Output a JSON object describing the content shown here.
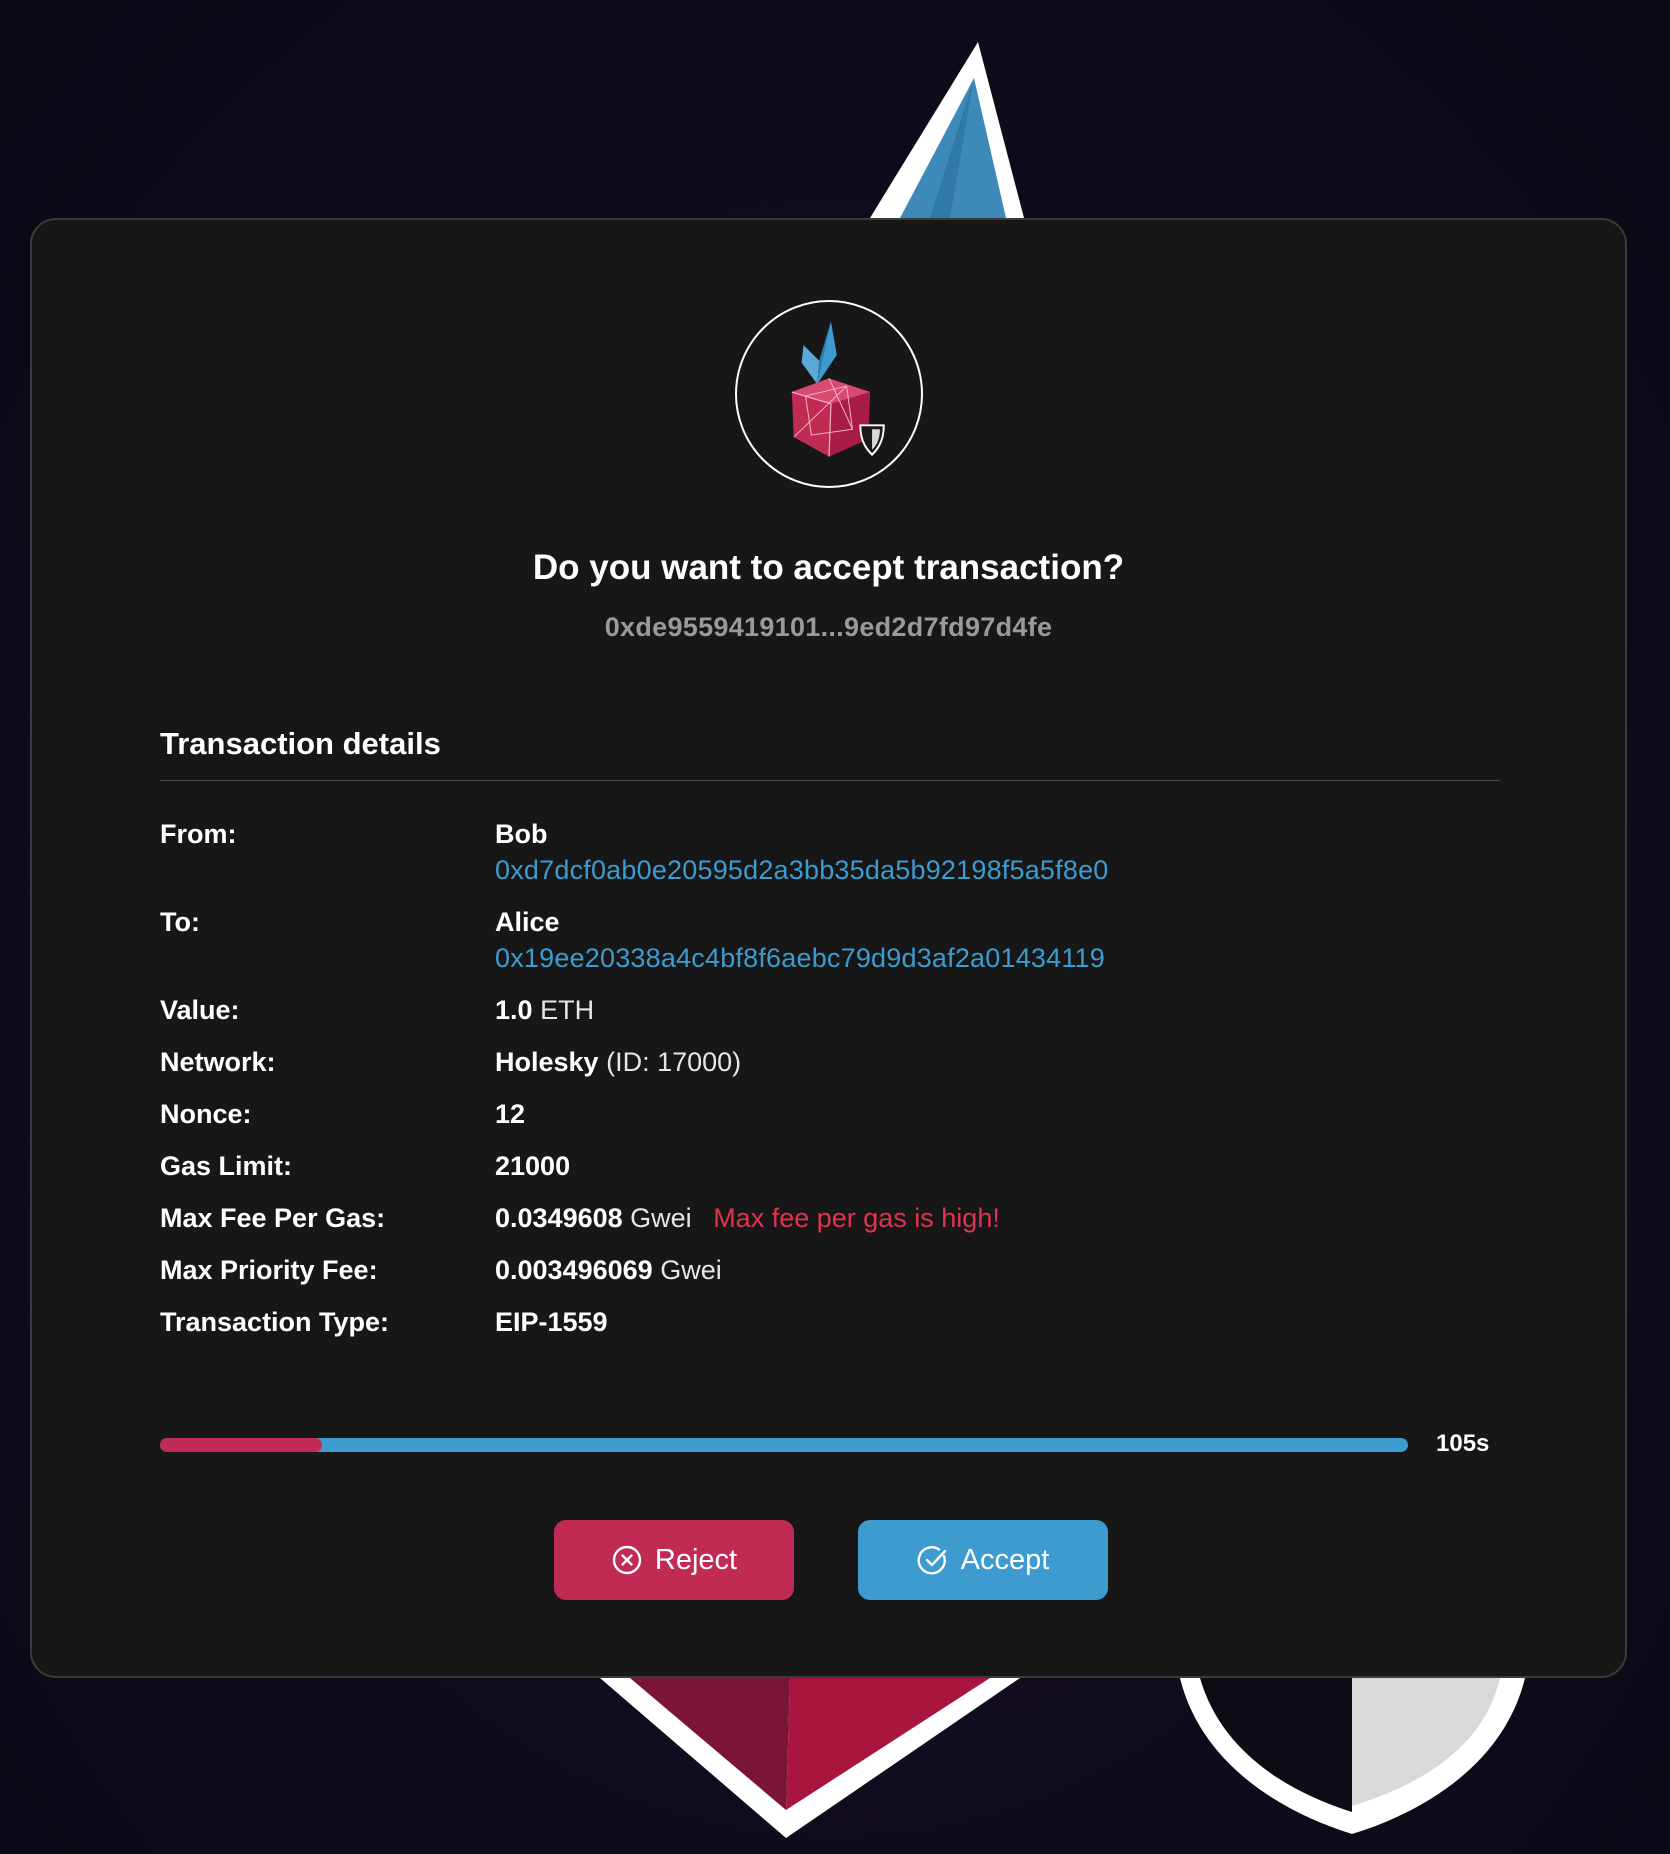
{
  "dialog": {
    "title": "Do you want to accept transaction?",
    "tx_hash": "0xde9559419101...9ed2d7fd97d4fe"
  },
  "details": {
    "heading": "Transaction details",
    "from": {
      "label": "From:",
      "name": "Bob",
      "address": "0xd7dcf0ab0e20595d2a3bb35da5b92198f5a5f8e0"
    },
    "to": {
      "label": "To:",
      "name": "Alice",
      "address": "0x19ee20338a4c4bf8f6aebc79d9d3af2a01434119"
    },
    "value": {
      "label": "Value:",
      "amount": "1.0",
      "unit": "ETH"
    },
    "network": {
      "label": "Network:",
      "name": "Holesky",
      "id": "(ID: 17000)"
    },
    "nonce": {
      "label": "Nonce:",
      "value": "12"
    },
    "gas_limit": {
      "label": "Gas Limit:",
      "value": "21000"
    },
    "max_fee": {
      "label": "Max Fee Per Gas:",
      "amount": "0.0349608",
      "unit": "Gwei",
      "warning": "Max fee per gas is high!"
    },
    "max_priority_fee": {
      "label": "Max Priority Fee:",
      "amount": "0.003496069",
      "unit": "Gwei"
    },
    "tx_type": {
      "label": "Transaction Type:",
      "value": "EIP-1559"
    }
  },
  "timer": {
    "label": "105s",
    "elapsed_fraction": 0.13
  },
  "actions": {
    "reject_label": "Reject",
    "accept_label": "Accept"
  },
  "icons": {
    "logo": "crystal-shield-logo-icon",
    "reject": "x-circle-icon",
    "accept": "check-circle-icon"
  },
  "colors": {
    "card_bg": "#171717",
    "accent_blue": "#3d9bd0",
    "accent_red": "#c02a55",
    "warning_red": "#e0334f",
    "muted_text": "#9a9a9a"
  }
}
